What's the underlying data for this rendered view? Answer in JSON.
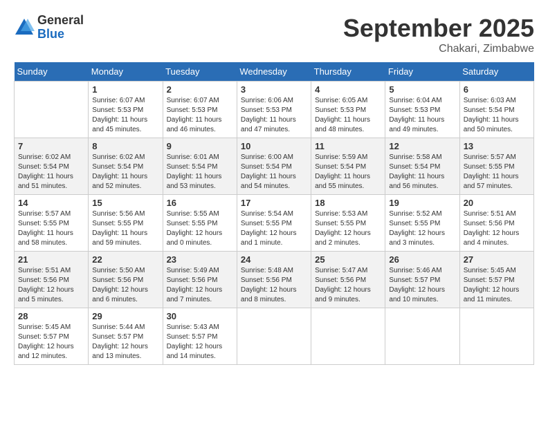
{
  "logo": {
    "general": "General",
    "blue": "Blue"
  },
  "title": {
    "month_year": "September 2025",
    "location": "Chakari, Zimbabwe"
  },
  "days_of_week": [
    "Sunday",
    "Monday",
    "Tuesday",
    "Wednesday",
    "Thursday",
    "Friday",
    "Saturday"
  ],
  "weeks": [
    [
      {
        "day": "",
        "sunrise": "",
        "sunset": "",
        "daylight": ""
      },
      {
        "day": "1",
        "sunrise": "Sunrise: 6:07 AM",
        "sunset": "Sunset: 5:53 PM",
        "daylight": "Daylight: 11 hours and 45 minutes."
      },
      {
        "day": "2",
        "sunrise": "Sunrise: 6:07 AM",
        "sunset": "Sunset: 5:53 PM",
        "daylight": "Daylight: 11 hours and 46 minutes."
      },
      {
        "day": "3",
        "sunrise": "Sunrise: 6:06 AM",
        "sunset": "Sunset: 5:53 PM",
        "daylight": "Daylight: 11 hours and 47 minutes."
      },
      {
        "day": "4",
        "sunrise": "Sunrise: 6:05 AM",
        "sunset": "Sunset: 5:53 PM",
        "daylight": "Daylight: 11 hours and 48 minutes."
      },
      {
        "day": "5",
        "sunrise": "Sunrise: 6:04 AM",
        "sunset": "Sunset: 5:53 PM",
        "daylight": "Daylight: 11 hours and 49 minutes."
      },
      {
        "day": "6",
        "sunrise": "Sunrise: 6:03 AM",
        "sunset": "Sunset: 5:54 PM",
        "daylight": "Daylight: 11 hours and 50 minutes."
      }
    ],
    [
      {
        "day": "7",
        "sunrise": "Sunrise: 6:02 AM",
        "sunset": "Sunset: 5:54 PM",
        "daylight": "Daylight: 11 hours and 51 minutes."
      },
      {
        "day": "8",
        "sunrise": "Sunrise: 6:02 AM",
        "sunset": "Sunset: 5:54 PM",
        "daylight": "Daylight: 11 hours and 52 minutes."
      },
      {
        "day": "9",
        "sunrise": "Sunrise: 6:01 AM",
        "sunset": "Sunset: 5:54 PM",
        "daylight": "Daylight: 11 hours and 53 minutes."
      },
      {
        "day": "10",
        "sunrise": "Sunrise: 6:00 AM",
        "sunset": "Sunset: 5:54 PM",
        "daylight": "Daylight: 11 hours and 54 minutes."
      },
      {
        "day": "11",
        "sunrise": "Sunrise: 5:59 AM",
        "sunset": "Sunset: 5:54 PM",
        "daylight": "Daylight: 11 hours and 55 minutes."
      },
      {
        "day": "12",
        "sunrise": "Sunrise: 5:58 AM",
        "sunset": "Sunset: 5:54 PM",
        "daylight": "Daylight: 11 hours and 56 minutes."
      },
      {
        "day": "13",
        "sunrise": "Sunrise: 5:57 AM",
        "sunset": "Sunset: 5:55 PM",
        "daylight": "Daylight: 11 hours and 57 minutes."
      }
    ],
    [
      {
        "day": "14",
        "sunrise": "Sunrise: 5:57 AM",
        "sunset": "Sunset: 5:55 PM",
        "daylight": "Daylight: 11 hours and 58 minutes."
      },
      {
        "day": "15",
        "sunrise": "Sunrise: 5:56 AM",
        "sunset": "Sunset: 5:55 PM",
        "daylight": "Daylight: 11 hours and 59 minutes."
      },
      {
        "day": "16",
        "sunrise": "Sunrise: 5:55 AM",
        "sunset": "Sunset: 5:55 PM",
        "daylight": "Daylight: 12 hours and 0 minutes."
      },
      {
        "day": "17",
        "sunrise": "Sunrise: 5:54 AM",
        "sunset": "Sunset: 5:55 PM",
        "daylight": "Daylight: 12 hours and 1 minute."
      },
      {
        "day": "18",
        "sunrise": "Sunrise: 5:53 AM",
        "sunset": "Sunset: 5:55 PM",
        "daylight": "Daylight: 12 hours and 2 minutes."
      },
      {
        "day": "19",
        "sunrise": "Sunrise: 5:52 AM",
        "sunset": "Sunset: 5:55 PM",
        "daylight": "Daylight: 12 hours and 3 minutes."
      },
      {
        "day": "20",
        "sunrise": "Sunrise: 5:51 AM",
        "sunset": "Sunset: 5:56 PM",
        "daylight": "Daylight: 12 hours and 4 minutes."
      }
    ],
    [
      {
        "day": "21",
        "sunrise": "Sunrise: 5:51 AM",
        "sunset": "Sunset: 5:56 PM",
        "daylight": "Daylight: 12 hours and 5 minutes."
      },
      {
        "day": "22",
        "sunrise": "Sunrise: 5:50 AM",
        "sunset": "Sunset: 5:56 PM",
        "daylight": "Daylight: 12 hours and 6 minutes."
      },
      {
        "day": "23",
        "sunrise": "Sunrise: 5:49 AM",
        "sunset": "Sunset: 5:56 PM",
        "daylight": "Daylight: 12 hours and 7 minutes."
      },
      {
        "day": "24",
        "sunrise": "Sunrise: 5:48 AM",
        "sunset": "Sunset: 5:56 PM",
        "daylight": "Daylight: 12 hours and 8 minutes."
      },
      {
        "day": "25",
        "sunrise": "Sunrise: 5:47 AM",
        "sunset": "Sunset: 5:56 PM",
        "daylight": "Daylight: 12 hours and 9 minutes."
      },
      {
        "day": "26",
        "sunrise": "Sunrise: 5:46 AM",
        "sunset": "Sunset: 5:57 PM",
        "daylight": "Daylight: 12 hours and 10 minutes."
      },
      {
        "day": "27",
        "sunrise": "Sunrise: 5:45 AM",
        "sunset": "Sunset: 5:57 PM",
        "daylight": "Daylight: 12 hours and 11 minutes."
      }
    ],
    [
      {
        "day": "28",
        "sunrise": "Sunrise: 5:45 AM",
        "sunset": "Sunset: 5:57 PM",
        "daylight": "Daylight: 12 hours and 12 minutes."
      },
      {
        "day": "29",
        "sunrise": "Sunrise: 5:44 AM",
        "sunset": "Sunset: 5:57 PM",
        "daylight": "Daylight: 12 hours and 13 minutes."
      },
      {
        "day": "30",
        "sunrise": "Sunrise: 5:43 AM",
        "sunset": "Sunset: 5:57 PM",
        "daylight": "Daylight: 12 hours and 14 minutes."
      },
      {
        "day": "",
        "sunrise": "",
        "sunset": "",
        "daylight": ""
      },
      {
        "day": "",
        "sunrise": "",
        "sunset": "",
        "daylight": ""
      },
      {
        "day": "",
        "sunrise": "",
        "sunset": "",
        "daylight": ""
      },
      {
        "day": "",
        "sunrise": "",
        "sunset": "",
        "daylight": ""
      }
    ]
  ]
}
